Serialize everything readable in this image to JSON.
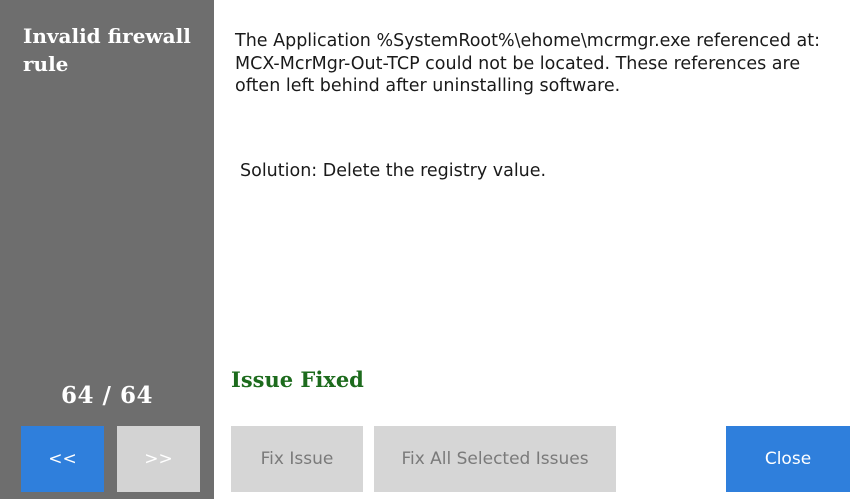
{
  "sidebar": {
    "title": "Invalid firewall rule",
    "counter": "64 / 64",
    "prev_label": "<<",
    "next_label": ">>"
  },
  "content": {
    "message": "The Application %SystemRoot%\\ehome\\mcrmgr.exe referenced at: MCX-McrMgr-Out-TCP could not be located. These references are often left behind after uninstalling software.",
    "solution": "Solution: Delete the registry value.",
    "status": "Issue Fixed"
  },
  "actions": {
    "fix_issue_label": "Fix Issue",
    "fix_all_label": "Fix All Selected Issues",
    "close_label": "Close"
  },
  "colors": {
    "sidebar_bg": "#6e6e6e",
    "accent_blue": "#2f7fdc",
    "disabled_gray": "#d6d6d6",
    "status_green": "#1d6b1d"
  }
}
